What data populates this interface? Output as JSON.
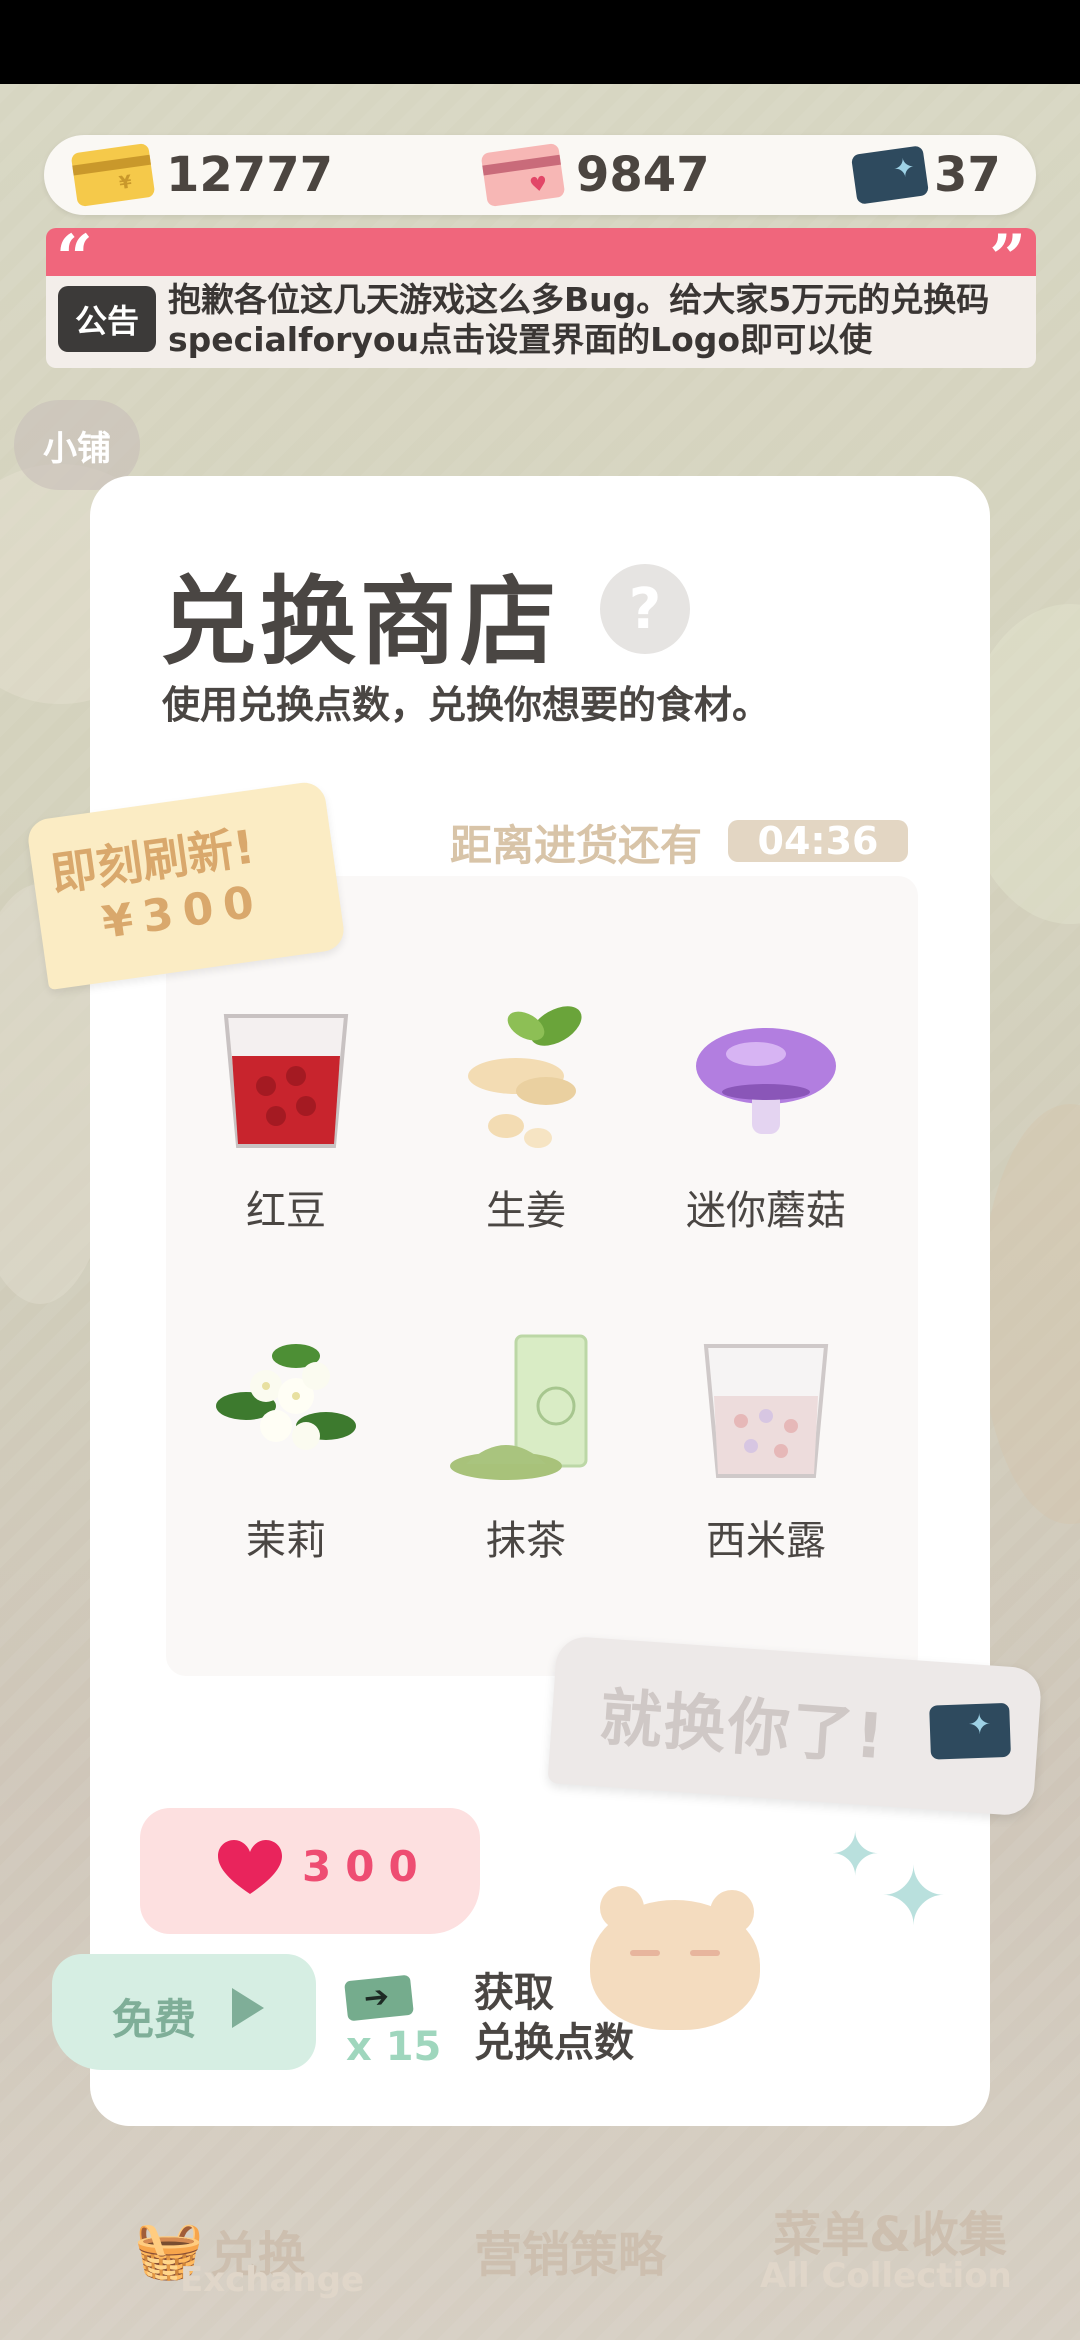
{
  "currencies": [
    {
      "name": "gold-card",
      "value": "12777",
      "color": "#f5c94a"
    },
    {
      "name": "pink-card",
      "value": "9847",
      "color": "#f7b7b5"
    },
    {
      "name": "exchange-ticket",
      "value": "37",
      "color": "#2e4a5e"
    }
  ],
  "notice": {
    "tag": "公告",
    "text": "抱歉各位这几天游戏这么多Bug。给大家5万元的兑换码specialforyou点击设置界面的Logo即可以使",
    "open_quote": "“",
    "close_quote": "”"
  },
  "background_tabs": {
    "shop": "小铺"
  },
  "shop": {
    "title": "兑换商店",
    "help": "?",
    "subtitle": "使用兑换点数，兑换你想要的食材。",
    "restock_label": "距离进货还有",
    "restock_timer": "04:36",
    "items": [
      {
        "name": "红豆",
        "icon": "red-bean-icon"
      },
      {
        "name": "生姜",
        "icon": "ginger-icon"
      },
      {
        "name": "迷你蘑菇",
        "icon": "mini-mushroom-icon"
      },
      {
        "name": "茉莉",
        "icon": "jasmine-icon"
      },
      {
        "name": "抹茶",
        "icon": "matcha-icon"
      },
      {
        "name": "西米露",
        "icon": "sago-icon"
      }
    ]
  },
  "refresh": {
    "title": "即刻刷新!",
    "price": "¥300"
  },
  "pick_button": "就换你了!",
  "hearts_button": {
    "value": "300"
  },
  "free_button": {
    "label": "免费"
  },
  "reward": {
    "count": "x 15",
    "line1": "获取",
    "line2": "兑换点数"
  },
  "bottom_nav": {
    "exchange": "兑换",
    "exchange_sub": "Exchange",
    "marketing": "营销策略",
    "menu": "菜单&收集",
    "menu_sub": "All Collection"
  },
  "colors": {
    "accent_pink": "#f0667c",
    "panel": "#ffffff",
    "text_dark": "#4a4643"
  }
}
